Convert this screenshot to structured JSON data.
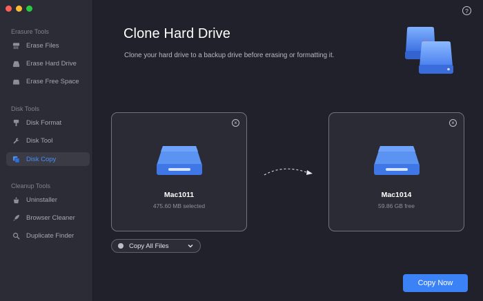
{
  "window": {
    "traffic_colors": [
      "#ff5f57",
      "#febc2e",
      "#28c840"
    ]
  },
  "sidebar": {
    "sections": [
      {
        "title": "Erasure Tools",
        "items": [
          {
            "label": "Erase Files",
            "icon": "shredder-icon"
          },
          {
            "label": "Erase Hard Drive",
            "icon": "hard-drive-erase-icon"
          },
          {
            "label": "Erase Free Space",
            "icon": "free-space-icon"
          }
        ]
      },
      {
        "title": "Disk Tools",
        "items": [
          {
            "label": "Disk Format",
            "icon": "brush-icon"
          },
          {
            "label": "Disk Tool",
            "icon": "wrench-icon"
          },
          {
            "label": "Disk Copy",
            "icon": "copy-icon",
            "active": true
          }
        ]
      },
      {
        "title": "Cleanup Tools",
        "items": [
          {
            "label": "Uninstaller",
            "icon": "uninstall-icon"
          },
          {
            "label": "Browser Cleaner",
            "icon": "rocket-icon"
          },
          {
            "label": "Duplicate Finder",
            "icon": "search-icon"
          }
        ]
      }
    ],
    "active_color": "#4a8df8"
  },
  "header": {
    "title": "Clone Hard Drive",
    "subtitle": "Clone your hard drive to a backup drive before erasing or formatting it.",
    "help_label": "?"
  },
  "source_drive": {
    "name": "Mac1011",
    "info": "475.60 MB selected",
    "close_label": "×"
  },
  "target_drive": {
    "name": "Mac1014",
    "info": "59.86 GB free",
    "close_label": "×"
  },
  "copy_mode": {
    "selected": "Copy All Files"
  },
  "actions": {
    "copy_now_label": "Copy Now",
    "accent_color": "#3b82f6"
  }
}
